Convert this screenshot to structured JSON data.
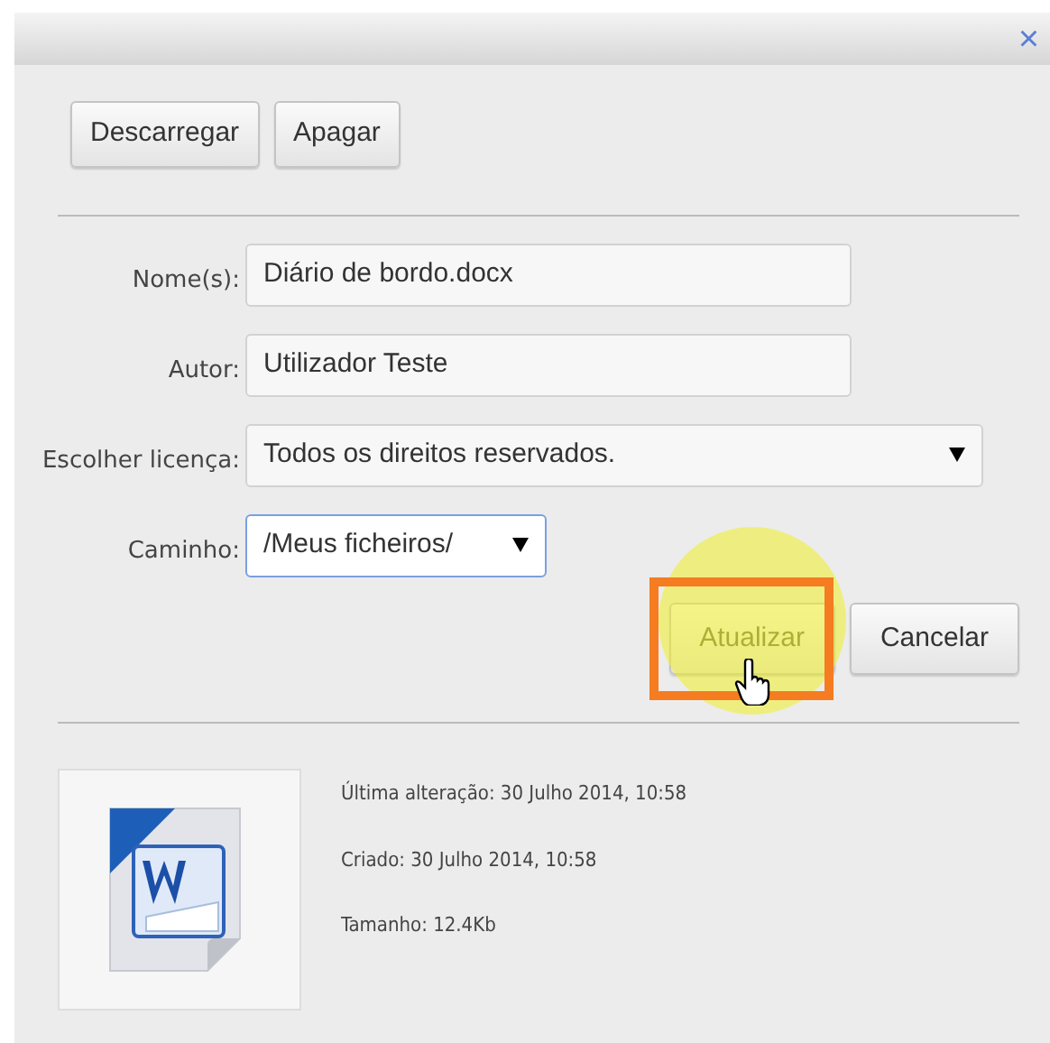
{
  "dialog": {
    "close": "×"
  },
  "actions": [
    {
      "label": "Descarregar",
      "disabled": false
    },
    {
      "label": "Apagar",
      "disabled": false
    }
  ],
  "fields": [
    {
      "kind": "text",
      "label": "Nome(s):",
      "value": "Diário de bordo.docx",
      "focused": false
    },
    {
      "kind": "text",
      "label": "Autor:",
      "value": "Utilizador Teste",
      "focused": false
    },
    {
      "kind": "select",
      "label": "Escolher licença:",
      "value": "Todos os direitos reservados.",
      "focused": false,
      "wide": true
    },
    {
      "kind": "select",
      "label": "Caminho:",
      "value": "/Meus ficheiros/",
      "focused": true,
      "wide": false
    }
  ],
  "footer_buttons": [
    {
      "label": "Atualizar",
      "disabled": true,
      "highlighted": true
    },
    {
      "label": "Cancelar",
      "disabled": false,
      "highlighted": false
    }
  ],
  "details": [
    "Última alteração: 30 Julho 2014, 10:58",
    "Criado: 30 Julho 2014, 10:58",
    "Tamanho: 12.4Kb"
  ]
}
